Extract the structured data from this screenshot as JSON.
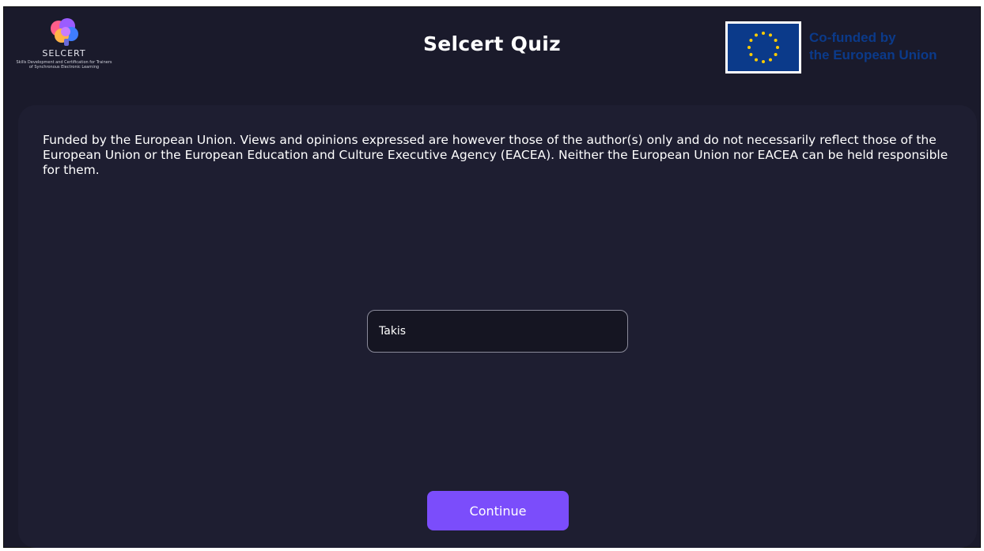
{
  "header": {
    "logo_word": "SELCERT",
    "logo_subtitle": "Skills Development and Certification for Trainers of Synchronous Electronic Learning",
    "title": "Selcert Quiz",
    "eu_line1": "Co-funded by",
    "eu_line2": "the European Union"
  },
  "main": {
    "disclaimer": "Funded by the European Union. Views and opinions expressed are however those of the author(s) only and do not necessarily reflect those of the European Union or the European Education and Culture Executive Agency (EACEA). Neither the European Union nor EACEA can be held responsible for them.",
    "name_value": "Takis",
    "continue_label": "Continue"
  },
  "colors": {
    "background": "#1a1a2b",
    "card": "#1e1e31",
    "accent": "#7b4dfb",
    "eu_blue": "#0b3a8a",
    "eu_star": "#ffcc00"
  },
  "icons": {
    "logo": "brain-icon",
    "flag": "eu-flag-icon"
  }
}
